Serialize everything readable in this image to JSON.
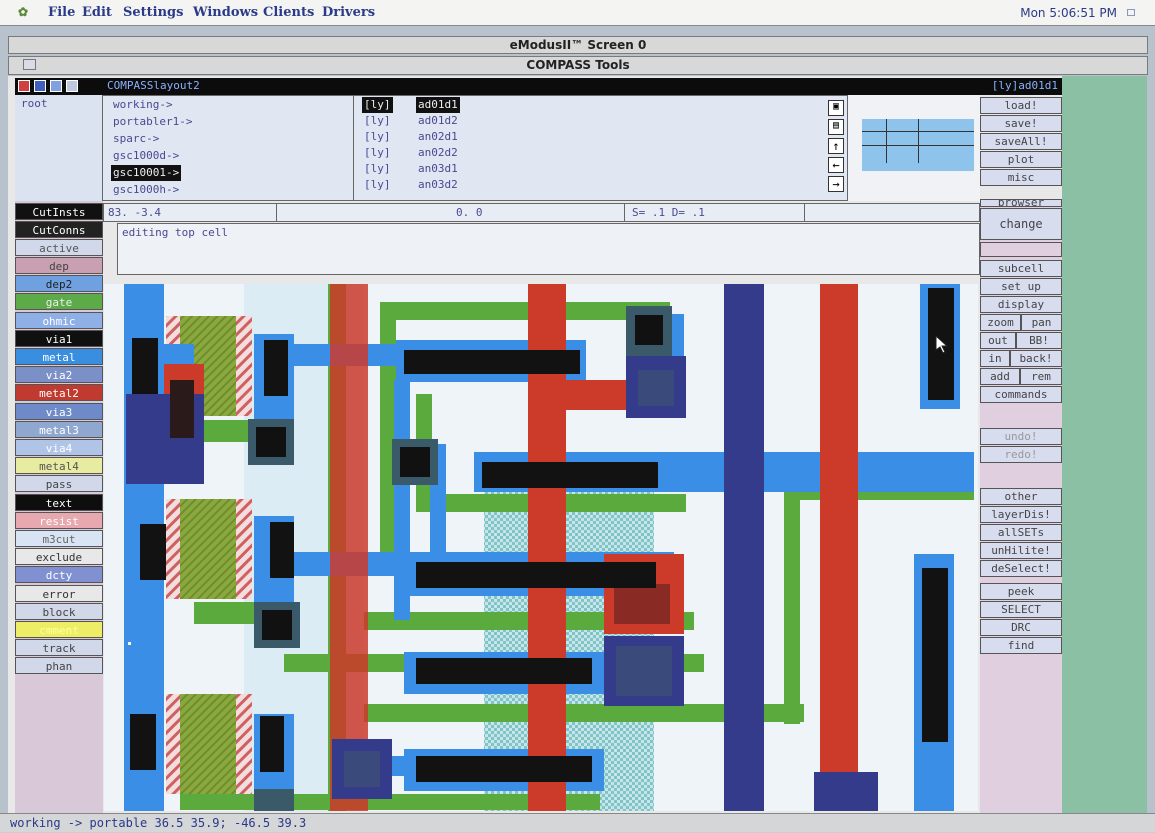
{
  "menubar": {
    "items": [
      "File",
      "Edit",
      "Settings",
      "Windows",
      "Clients",
      "Drivers"
    ],
    "clock": "Mon 5:06:51 PM"
  },
  "window_title": "eModusII™ Screen 0",
  "app_title": "COMPASS Tools",
  "layout_title": "COMPASSlayout2",
  "cell_name": "[ly]ad01d1",
  "root_label": "root",
  "libraries": [
    "working->",
    "portabler1->",
    "sparc->",
    "gsc1000d->",
    "gsc10001->",
    "gsc1000h->"
  ],
  "selected_library": "gsc10001->",
  "cells": [
    {
      "tag": "[ly]",
      "name": "ad01d1"
    },
    {
      "tag": "[ly]",
      "name": "ad01d2"
    },
    {
      "tag": "[ly]",
      "name": "an02d1"
    },
    {
      "tag": "[ly]",
      "name": "an02d2"
    },
    {
      "tag": "[ly]",
      "name": "an03d1"
    },
    {
      "tag": "[ly]",
      "name": "an03d2"
    }
  ],
  "nav_icons": [
    "zoom-in-icon",
    "zoom-out-icon",
    "up-arrow-icon",
    "left-arrow-icon",
    "right-arrow-icon"
  ],
  "top_buttons": [
    "load!",
    "save!",
    "saveAll!",
    "plot",
    "misc"
  ],
  "coord_bar": {
    "coords": "83. -3.4",
    "offset": "0. 0",
    "snap": "S= .1 D= .1"
  },
  "message": "editing top cell",
  "side_top": [
    "CutInsts",
    "CutConns",
    "active"
  ],
  "layers": [
    {
      "name": "dep",
      "bg": "#c8a0b0",
      "fg": "#444"
    },
    {
      "name": "dep2",
      "bg": "#6fa0e0",
      "fg": "#222"
    },
    {
      "name": "gate",
      "bg": "#5caa48",
      "fg": "#eee"
    },
    {
      "name": "ohmic",
      "bg": "#8fb0e6",
      "fg": "#fff"
    },
    {
      "name": "via1",
      "bg": "#101010",
      "fg": "#fff"
    },
    {
      "name": "metal",
      "bg": "#3a8ee0",
      "fg": "#fff"
    },
    {
      "name": "via2",
      "bg": "#7c90c8",
      "fg": "#fff"
    },
    {
      "name": "metal2",
      "bg": "#c03a30",
      "fg": "#fff"
    },
    {
      "name": "via3",
      "bg": "#6e8ac8",
      "fg": "#fff"
    },
    {
      "name": "metal3",
      "bg": "#90a8d0",
      "fg": "#fff"
    },
    {
      "name": "via4",
      "bg": "#b0c4e8",
      "fg": "#fff"
    },
    {
      "name": "metal4",
      "bg": "#e8eca0",
      "fg": "#555"
    },
    {
      "name": "pass",
      "bg": "#d0d8ea",
      "fg": "#444"
    },
    {
      "name": "text",
      "bg": "#0e0e0e",
      "fg": "#fff"
    },
    {
      "name": "resist",
      "bg": "#e8a8b0",
      "fg": "#fff"
    },
    {
      "name": "m3cut",
      "bg": "#d8e4f4",
      "fg": "#666"
    },
    {
      "name": "exclude",
      "bg": "#e8e8e8",
      "fg": "#333"
    },
    {
      "name": "dcty",
      "bg": "#8090d0",
      "fg": "#fff"
    },
    {
      "name": "error",
      "bg": "#e8e8e8",
      "fg": "#333"
    },
    {
      "name": "block",
      "bg": "#d0d8ea",
      "fg": "#444"
    },
    {
      "name": "cmment",
      "bg": "#eeee66",
      "fg": "#ffff99"
    },
    {
      "name": "track",
      "bg": "#d0d8ea",
      "fg": "#444"
    },
    {
      "name": "phan",
      "bg": "#d0d8ea",
      "fg": "#444"
    }
  ],
  "right_buttons": {
    "browser": "browser",
    "change": "change",
    "subcell": "subcell",
    "setup": "set up",
    "display": "display",
    "zoom": "zoom",
    "pan": "pan",
    "out": "out",
    "bb": "BB!",
    "in": "in",
    "back": "back!",
    "add": "add",
    "rem": "rem",
    "commands": "commands",
    "undo": "undo!",
    "redo": "redo!",
    "other": "other",
    "layerDis": "layerDis!",
    "allSETs": "allSETs",
    "unHilite": "unHilite!",
    "deSelect": "deSelect!",
    "peek": "peek",
    "select": "SELECT",
    "drc": "DRC",
    "find": "find"
  },
  "status": "working -> portable 36.5 35.9; -46.5 39.3",
  "colors": {
    "metal1": "#3b8ee6",
    "metal2": "#cc3a2a",
    "poly": "#5aaa3e",
    "via": "#121212",
    "dense": "#333b8a"
  }
}
